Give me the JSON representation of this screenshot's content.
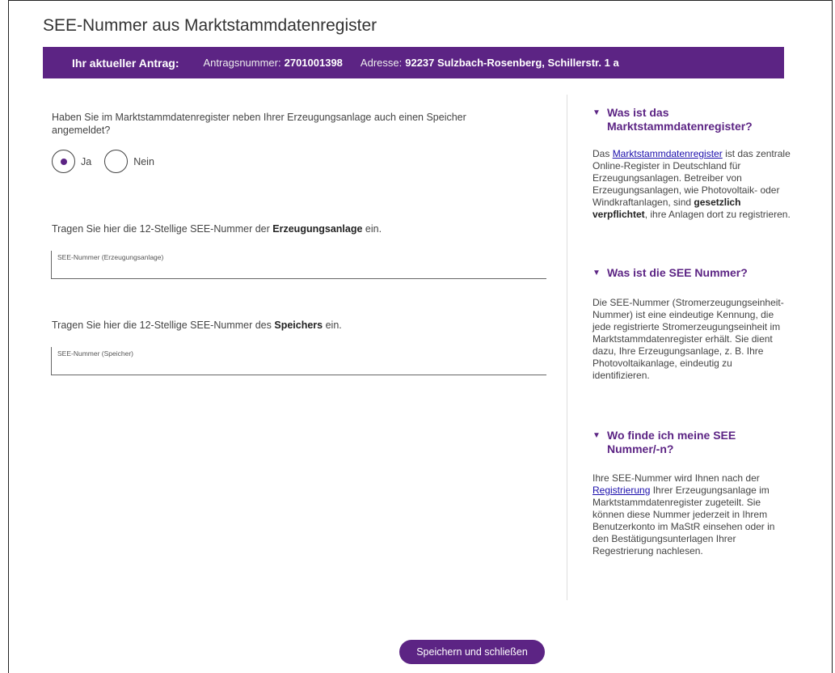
{
  "page": {
    "title": "SEE-Nummer aus Marktstammdatenregister"
  },
  "banner": {
    "title": "Ihr aktueller Antrag:",
    "antrag_label": "Antragsnummer:",
    "antrag_value": "2701001398",
    "adresse_label": "Adresse:",
    "adresse_value": "92237 Sulzbach-Rosenberg, Schillerstr. 1 a"
  },
  "form": {
    "question": "Haben Sie im Marktstammdatenregister neben Ihrer Erzeugungsanlage auch einen Speicher angemeldet?",
    "options": [
      {
        "label": "Ja",
        "selected": true
      },
      {
        "label": "Nein",
        "selected": false
      }
    ],
    "erzeugung_prefix": "Tragen Sie hier die 12-Stellige SEE-Nummer der ",
    "erzeugung_bold": "Erzeugungsanlage",
    "erzeugung_suffix": " ein.",
    "erzeugung_field_label": "SEE-Nummer (Erzeugungsanlage)",
    "speicher_prefix": "Tragen Sie hier die 12-Stellige SEE-Nummer des ",
    "speicher_bold": "Speichers",
    "speicher_suffix": " ein.",
    "speicher_field_label": "SEE-Nummer (Speicher)"
  },
  "sidebar": {
    "triangle": "▼",
    "s1": {
      "heading": "Was ist das Marktstammdatenregister?",
      "text_1": "Das ",
      "link": "Marktstammdatenregister",
      "text_2": " ist das zentrale Online-Register in Deutschland für Erzeugungsanlagen. Betreiber von Erzeugungsanlagen, wie Photovoltaik- oder Windkraftanlagen, sind ",
      "bold": "gesetzlich verpflichtet",
      "text_3": ", ihre Anlagen dort zu registrieren."
    },
    "s2": {
      "heading": "Was ist die SEE Nummer?",
      "text": "Die SEE-Nummer (Stromerzeugungseinheit-Nummer) ist eine eindeutige Kennung, die jede registrierte Stromerzeugungseinheit im Marktstammdatenregister erhält. Sie dient dazu, Ihre Erzeugungsanlage, z. B. Ihre Photovoltaikanlage, eindeutig zu identifizieren."
    },
    "s3": {
      "heading": "Wo finde ich meine SEE Nummer/-n?",
      "text_1": "Ihre SEE-Nummer wird Ihnen nach der ",
      "link": "Registrierung",
      "text_2": " Ihrer Erzeugungsanlage im Marktstammdatenregister zugeteilt. Sie können diese Nummer jederzeit in Ihrem Benutzerkonto im MaStR einsehen oder in den Bestätigungsunterlagen Ihrer Regestrierung nachlesen."
    }
  },
  "actions": {
    "save_label": "Speichern und schließen"
  },
  "colors": {
    "accent": "#5c2484",
    "link": "#1a0dab"
  }
}
